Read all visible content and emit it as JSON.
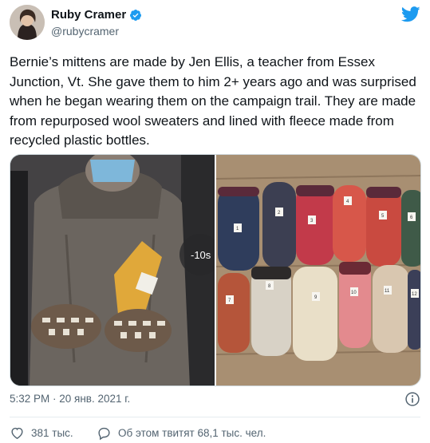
{
  "author": {
    "display_name": "Ruby Cramer",
    "handle": "@rubycramer",
    "verified": true
  },
  "tweet": {
    "text": "Bernie’s mittens are made by Jen Ellis, a teacher from Essex Junction, Vt. She gave them to him 2+ years ago and was surprised when he began wearing them on the campaign trail. They are made from repurposed wool sweaters and lined with fleece made from recycled plastic bottles.",
    "timestamp": "5:32 PM · 20 янв. 2021 г."
  },
  "media": {
    "left_overlay_text": "-10s",
    "tag_numbers": [
      "1",
      "2",
      "3",
      "4",
      "5",
      "6",
      "7",
      "8",
      "9",
      "10",
      "11",
      "12"
    ]
  },
  "actions": {
    "like_count": "381 тыс.",
    "reply_label": "Об этом твитят 68,1 тыс. чел."
  },
  "colors": {
    "twitter_blue": "#1d9bf0",
    "text": "#0f1419",
    "secondary": "#536471"
  },
  "icons": {
    "verified": "verified-badge-icon",
    "logo": "twitter-bird-icon",
    "info": "info-icon",
    "like": "heart-icon",
    "reply": "chat-bubble-icon"
  }
}
